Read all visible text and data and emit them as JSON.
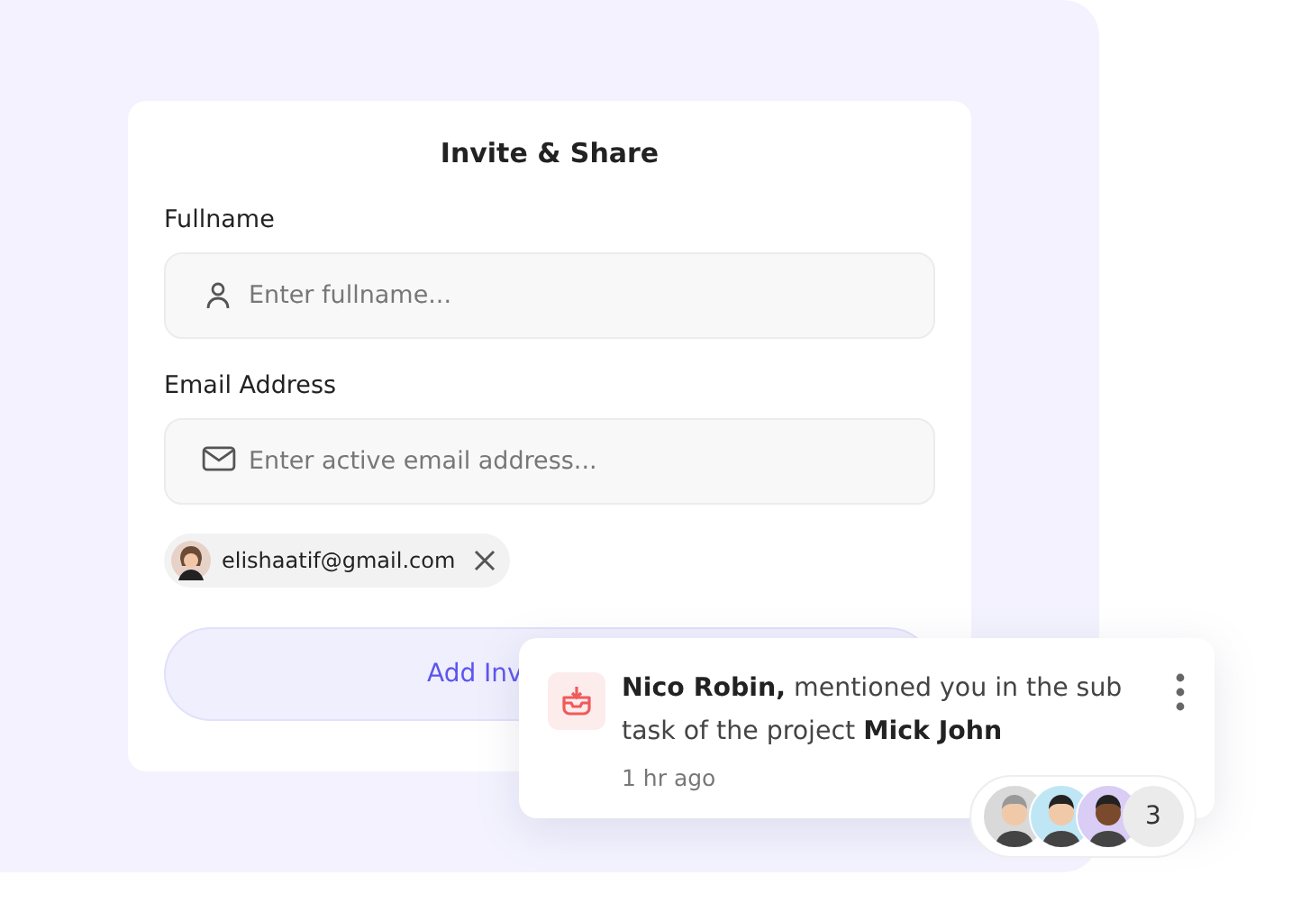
{
  "form": {
    "title": "Invite & Share",
    "fields": [
      {
        "kind": "person",
        "label": "Fullname",
        "placeholder": "Enter fullname..."
      },
      {
        "kind": "email",
        "label": "Email Address",
        "placeholder": "Enter active email address..."
      }
    ],
    "chips": [
      {
        "text": "elishaatif@gmail.com"
      }
    ],
    "button": "Add Inv"
  },
  "notification": {
    "message": "**Nico Robin,** mentioned you in the sub task of the project **Mick John**",
    "time": "1 hr ago",
    "avatars": [
      {
        "color": "#d9d9d9"
      },
      {
        "color": "#bfe6f5"
      },
      {
        "color": "#d9ccf5"
      }
    ],
    "count": "3"
  }
}
